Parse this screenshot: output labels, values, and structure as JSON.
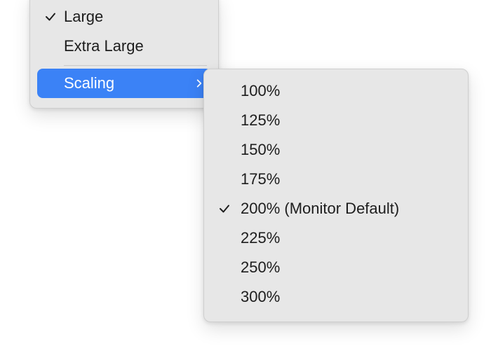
{
  "menu": {
    "size_items": [
      {
        "label": "Large",
        "checked": true
      },
      {
        "label": "Extra Large",
        "checked": false
      }
    ],
    "scaling_label": "Scaling"
  },
  "submenu": {
    "items": [
      {
        "label": "100%",
        "checked": false
      },
      {
        "label": "125%",
        "checked": false
      },
      {
        "label": "150%",
        "checked": false
      },
      {
        "label": "175%",
        "checked": false
      },
      {
        "label": "200% (Monitor Default)",
        "checked": true
      },
      {
        "label": "225%",
        "checked": false
      },
      {
        "label": "250%",
        "checked": false
      },
      {
        "label": "300%",
        "checked": false
      }
    ]
  }
}
